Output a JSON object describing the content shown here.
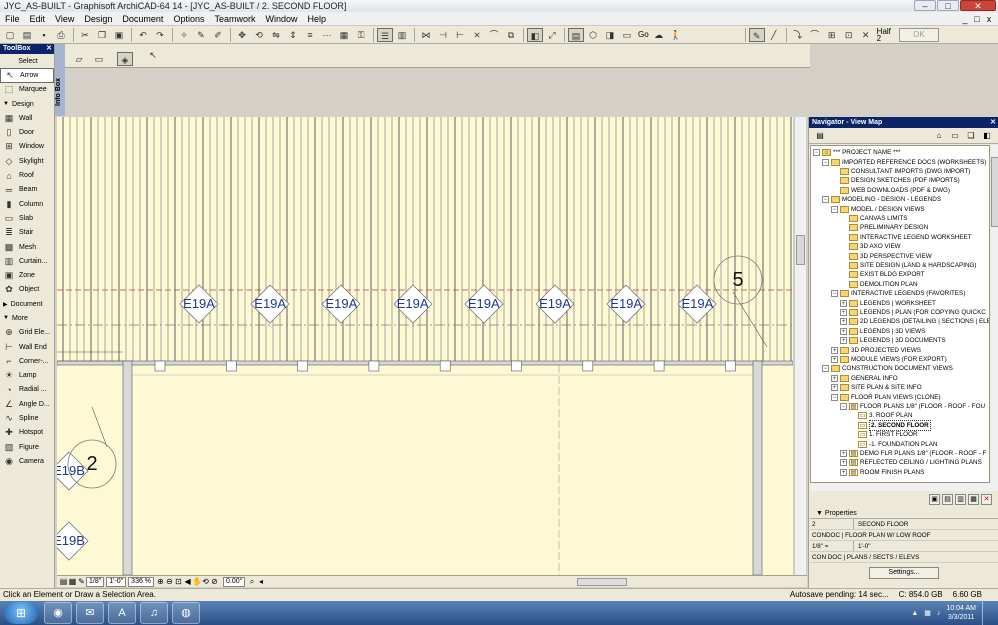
{
  "window": {
    "title": "JYC_AS-BUILT - Graphisoft ArchiCAD-64 14 - [JYC_AS-BUILT / 2. SECOND FLOOR]",
    "controls": [
      "–",
      "□",
      "✕"
    ]
  },
  "menu": [
    "File",
    "Edit",
    "View",
    "Design",
    "Document",
    "Options",
    "Teamwork",
    "Window",
    "Help"
  ],
  "mdi_controls": [
    "_",
    "□",
    "x"
  ],
  "toolbar": {
    "zoom_label": "Go",
    "half_label": "Half",
    "half_value": "2",
    "ok_label": "OK"
  },
  "toolbox": {
    "title": "ToolBox",
    "select_label": "Select",
    "design_label": "Design",
    "document_label": "Document",
    "more_label": "More",
    "select_tools": [
      {
        "label": "Arrow",
        "icon": "↖"
      },
      {
        "label": "Marquee",
        "icon": "⬚"
      }
    ],
    "design_tools": [
      {
        "label": "Wall",
        "icon": "▦"
      },
      {
        "label": "Door",
        "icon": "▯"
      },
      {
        "label": "Window",
        "icon": "⊞"
      },
      {
        "label": "Skylight",
        "icon": "◇"
      },
      {
        "label": "Roof",
        "icon": "⌂"
      },
      {
        "label": "Beam",
        "icon": "═"
      },
      {
        "label": "Column",
        "icon": "▮"
      },
      {
        "label": "Slab",
        "icon": "▭"
      },
      {
        "label": "Stair",
        "icon": "≣"
      },
      {
        "label": "Mesh",
        "icon": "▩"
      },
      {
        "label": "Curtain...",
        "icon": "▥"
      },
      {
        "label": "Zone",
        "icon": "▣"
      },
      {
        "label": "Object",
        "icon": "✿"
      }
    ],
    "more_tools": [
      {
        "label": "Grid Ele...",
        "icon": "⊕"
      },
      {
        "label": "Wall End",
        "icon": "⊢"
      },
      {
        "label": "Corner-...",
        "icon": "⌐"
      },
      {
        "label": "Lamp",
        "icon": "☀"
      },
      {
        "label": "Radial ...",
        "icon": "◔"
      },
      {
        "label": "Angle D...",
        "icon": "∠"
      },
      {
        "label": "Spline",
        "icon": "∿"
      },
      {
        "label": "Hotspot",
        "icon": "✚"
      },
      {
        "label": "Figure",
        "icon": "▨"
      },
      {
        "label": "Camera",
        "icon": "◉"
      }
    ]
  },
  "infobox": {
    "label": "Info Box"
  },
  "canvas": {
    "tags": [
      "E19A",
      "E19A",
      "E19A",
      "E19A",
      "E19A",
      "E19A",
      "E19A",
      "E19A"
    ],
    "left_tags": [
      "E19B",
      "E19B"
    ],
    "grid_bubbles": [
      "5",
      "2"
    ]
  },
  "view_status": {
    "scale": "1/8\"",
    "scale2": "1'-0\"",
    "zoom": "336 %",
    "angle": "0.00°"
  },
  "statusbar": {
    "hint": "Click an Element or Draw a Selection Area.",
    "autosave": "Autosave pending: 14 sec...",
    "disk_c": "C: 854.0 GB",
    "mem": "6.60 GB"
  },
  "navigator": {
    "title": "Navigator - View Map",
    "tree": [
      {
        "label": "*** PROJECT NAME ***",
        "level": 0,
        "type": "root",
        "expanded": true
      },
      {
        "label": "IMPORTED REFERENCE DOCS (WORKSHEETS)",
        "level": 1,
        "type": "folder",
        "expanded": true
      },
      {
        "label": "CONSULTANT IMPORTS (DWG IMPORT)",
        "level": 2,
        "type": "folder"
      },
      {
        "label": "DESIGN SKETCHES (PDF IMPORTS)",
        "level": 2,
        "type": "folder"
      },
      {
        "label": "WEB DOWNLOADS (PDF & DWG)",
        "level": 2,
        "type": "folder"
      },
      {
        "label": "MODELING - DESIGN - LEGENDS",
        "level": 1,
        "type": "folder",
        "expanded": true
      },
      {
        "label": "MODEL / DESIGN VIEWS",
        "level": 2,
        "type": "folder",
        "expanded": true
      },
      {
        "label": "CANVAS LIMITS",
        "level": 3,
        "type": "folder"
      },
      {
        "label": "PRELIMINARY DESIGN",
        "level": 3,
        "type": "folder"
      },
      {
        "label": "INTERACTIVE LEGEND WORKSHEET",
        "level": 3,
        "type": "folder"
      },
      {
        "label": "3D AXO VIEW",
        "level": 3,
        "type": "folder"
      },
      {
        "label": "3D PERSPECTIVE VIEW",
        "level": 3,
        "type": "folder"
      },
      {
        "label": "SITE DESIGN (LAND & HARDSCAPING)",
        "level": 3,
        "type": "folder"
      },
      {
        "label": "EXIST BLDG EXPORT",
        "level": 3,
        "type": "folder"
      },
      {
        "label": "DEMOLITION PLAN",
        "level": 3,
        "type": "folder"
      },
      {
        "label": "INTERACTIVE LEGENDS (FAVORITES)",
        "level": 2,
        "type": "folder",
        "expanded": true
      },
      {
        "label": "LEGENDS | WORKSHEET",
        "level": 3,
        "type": "folder",
        "collapsed": true
      },
      {
        "label": "LEGENDS | PLAN (FOR COPYING QUICKC",
        "level": 3,
        "type": "folder",
        "collapsed": true
      },
      {
        "label": "2D LEGENDS (DETAILING | SECTIONS | ELE",
        "level": 3,
        "type": "folder",
        "collapsed": true
      },
      {
        "label": "LEGENDS | 3D VIEWS",
        "level": 3,
        "type": "folder",
        "collapsed": true
      },
      {
        "label": "LEGENDS | 3D DOCUMENTS",
        "level": 3,
        "type": "folder",
        "collapsed": true
      },
      {
        "label": "3D PROJECTED VIEWS",
        "level": 2,
        "type": "folder",
        "collapsed": true
      },
      {
        "label": "MODULE VIEWS (FOR EXPORT)",
        "level": 2,
        "type": "folder",
        "collapsed": true
      },
      {
        "label": "CONSTRUCTION DOCUMENT VIEWS",
        "level": 1,
        "type": "folder",
        "expanded": true
      },
      {
        "label": "GENERAL INFO",
        "level": 2,
        "type": "folder",
        "collapsed": true
      },
      {
        "label": "SITE PLAN & SITE INFO",
        "level": 2,
        "type": "folder",
        "collapsed": true
      },
      {
        "label": "FLOOR PLAN VIEWS (CLONE)",
        "level": 2,
        "type": "folder",
        "expanded": true
      },
      {
        "label": "FLOOR PLANS 1/8\" (FLOOR - ROOF - FOU",
        "level": 3,
        "type": "plan",
        "expanded": true
      },
      {
        "label": "3. ROOF PLAN",
        "level": 4,
        "type": "story"
      },
      {
        "label": "2. SECOND FLOOR",
        "level": 4,
        "type": "story",
        "selected": true
      },
      {
        "label": "1. FIRST FLOOR",
        "level": 4,
        "type": "story"
      },
      {
        "label": "-1. FOUNDATION PLAN",
        "level": 4,
        "type": "story"
      },
      {
        "label": "DEMO FLR PLANS 1/8\" (FLOOR - ROOF - F",
        "level": 3,
        "type": "plan",
        "collapsed": true
      },
      {
        "label": "REFLECTED CEILING / LIGHTING PLANS",
        "level": 3,
        "type": "plan",
        "collapsed": true
      },
      {
        "label": "ROOM FINISH PLANS",
        "level": 3,
        "type": "plan",
        "collapsed": true
      }
    ],
    "properties": {
      "header": "Properties",
      "rows": [
        {
          "c1": "2",
          "c2": "SECOND FLOOR"
        },
        {
          "c1": "CONDOC | FLOOR PLAN W/ LOW ROOF",
          "c2": ""
        },
        {
          "c1": "1/8\"  =",
          "c2": "1'-0\""
        },
        {
          "c1": "CON DOC | PLANS / SECTS / ELEVS",
          "c2": ""
        }
      ],
      "settings_label": "Settings..."
    }
  },
  "taskbar": {
    "apps": [
      "◉",
      "✉",
      "A",
      "♫",
      "◍"
    ],
    "time": "10:04 AM",
    "date": "3/3/2011"
  }
}
